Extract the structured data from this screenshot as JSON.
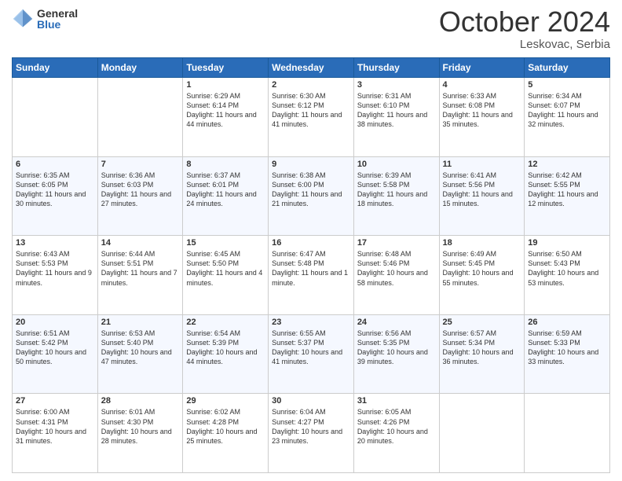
{
  "header": {
    "logo_general": "General",
    "logo_blue": "Blue",
    "month_title": "October 2024",
    "subtitle": "Leskovac, Serbia"
  },
  "days_of_week": [
    "Sunday",
    "Monday",
    "Tuesday",
    "Wednesday",
    "Thursday",
    "Friday",
    "Saturday"
  ],
  "weeks": [
    [
      {
        "day": "",
        "info": ""
      },
      {
        "day": "",
        "info": ""
      },
      {
        "day": "1",
        "info": "Sunrise: 6:29 AM\nSunset: 6:14 PM\nDaylight: 11 hours and 44 minutes."
      },
      {
        "day": "2",
        "info": "Sunrise: 6:30 AM\nSunset: 6:12 PM\nDaylight: 11 hours and 41 minutes."
      },
      {
        "day": "3",
        "info": "Sunrise: 6:31 AM\nSunset: 6:10 PM\nDaylight: 11 hours and 38 minutes."
      },
      {
        "day": "4",
        "info": "Sunrise: 6:33 AM\nSunset: 6:08 PM\nDaylight: 11 hours and 35 minutes."
      },
      {
        "day": "5",
        "info": "Sunrise: 6:34 AM\nSunset: 6:07 PM\nDaylight: 11 hours and 32 minutes."
      }
    ],
    [
      {
        "day": "6",
        "info": "Sunrise: 6:35 AM\nSunset: 6:05 PM\nDaylight: 11 hours and 30 minutes."
      },
      {
        "day": "7",
        "info": "Sunrise: 6:36 AM\nSunset: 6:03 PM\nDaylight: 11 hours and 27 minutes."
      },
      {
        "day": "8",
        "info": "Sunrise: 6:37 AM\nSunset: 6:01 PM\nDaylight: 11 hours and 24 minutes."
      },
      {
        "day": "9",
        "info": "Sunrise: 6:38 AM\nSunset: 6:00 PM\nDaylight: 11 hours and 21 minutes."
      },
      {
        "day": "10",
        "info": "Sunrise: 6:39 AM\nSunset: 5:58 PM\nDaylight: 11 hours and 18 minutes."
      },
      {
        "day": "11",
        "info": "Sunrise: 6:41 AM\nSunset: 5:56 PM\nDaylight: 11 hours and 15 minutes."
      },
      {
        "day": "12",
        "info": "Sunrise: 6:42 AM\nSunset: 5:55 PM\nDaylight: 11 hours and 12 minutes."
      }
    ],
    [
      {
        "day": "13",
        "info": "Sunrise: 6:43 AM\nSunset: 5:53 PM\nDaylight: 11 hours and 9 minutes."
      },
      {
        "day": "14",
        "info": "Sunrise: 6:44 AM\nSunset: 5:51 PM\nDaylight: 11 hours and 7 minutes."
      },
      {
        "day": "15",
        "info": "Sunrise: 6:45 AM\nSunset: 5:50 PM\nDaylight: 11 hours and 4 minutes."
      },
      {
        "day": "16",
        "info": "Sunrise: 6:47 AM\nSunset: 5:48 PM\nDaylight: 11 hours and 1 minute."
      },
      {
        "day": "17",
        "info": "Sunrise: 6:48 AM\nSunset: 5:46 PM\nDaylight: 10 hours and 58 minutes."
      },
      {
        "day": "18",
        "info": "Sunrise: 6:49 AM\nSunset: 5:45 PM\nDaylight: 10 hours and 55 minutes."
      },
      {
        "day": "19",
        "info": "Sunrise: 6:50 AM\nSunset: 5:43 PM\nDaylight: 10 hours and 53 minutes."
      }
    ],
    [
      {
        "day": "20",
        "info": "Sunrise: 6:51 AM\nSunset: 5:42 PM\nDaylight: 10 hours and 50 minutes."
      },
      {
        "day": "21",
        "info": "Sunrise: 6:53 AM\nSunset: 5:40 PM\nDaylight: 10 hours and 47 minutes."
      },
      {
        "day": "22",
        "info": "Sunrise: 6:54 AM\nSunset: 5:39 PM\nDaylight: 10 hours and 44 minutes."
      },
      {
        "day": "23",
        "info": "Sunrise: 6:55 AM\nSunset: 5:37 PM\nDaylight: 10 hours and 41 minutes."
      },
      {
        "day": "24",
        "info": "Sunrise: 6:56 AM\nSunset: 5:35 PM\nDaylight: 10 hours and 39 minutes."
      },
      {
        "day": "25",
        "info": "Sunrise: 6:57 AM\nSunset: 5:34 PM\nDaylight: 10 hours and 36 minutes."
      },
      {
        "day": "26",
        "info": "Sunrise: 6:59 AM\nSunset: 5:33 PM\nDaylight: 10 hours and 33 minutes."
      }
    ],
    [
      {
        "day": "27",
        "info": "Sunrise: 6:00 AM\nSunset: 4:31 PM\nDaylight: 10 hours and 31 minutes."
      },
      {
        "day": "28",
        "info": "Sunrise: 6:01 AM\nSunset: 4:30 PM\nDaylight: 10 hours and 28 minutes."
      },
      {
        "day": "29",
        "info": "Sunrise: 6:02 AM\nSunset: 4:28 PM\nDaylight: 10 hours and 25 minutes."
      },
      {
        "day": "30",
        "info": "Sunrise: 6:04 AM\nSunset: 4:27 PM\nDaylight: 10 hours and 23 minutes."
      },
      {
        "day": "31",
        "info": "Sunrise: 6:05 AM\nSunset: 4:26 PM\nDaylight: 10 hours and 20 minutes."
      },
      {
        "day": "",
        "info": ""
      },
      {
        "day": "",
        "info": ""
      }
    ]
  ]
}
